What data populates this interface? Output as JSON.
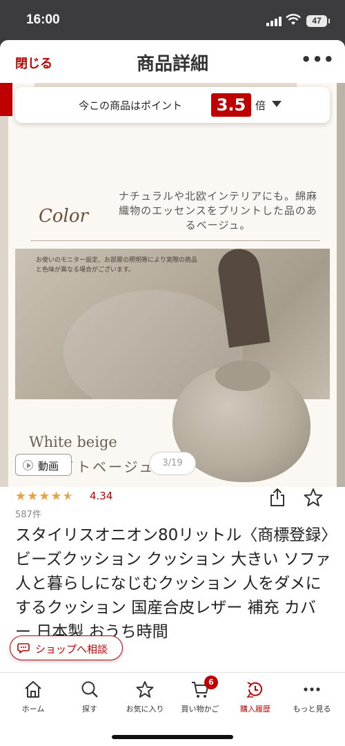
{
  "status_bar": {
    "time": "16:00",
    "battery": "47"
  },
  "header": {
    "close_label": "閉じる",
    "title": "商品詳細",
    "more_label": "•••"
  },
  "points_banner": {
    "prefix": "今この商品はポイント",
    "rate": "3.5",
    "unit": "倍"
  },
  "product_image": {
    "color_word": "Color",
    "description": "ナチュラルや北欧インテリアにも。綿麻織物のエッセンスをプリントした品のあるベージュ。",
    "monitor_note": "お使いのモニター設定、お部屋の照明等により実際の商品と色味が異なる場合がございます。",
    "color_name_en": "White beige",
    "color_name_ja": "ホワイトベージュ"
  },
  "media": {
    "video_label": "動画",
    "counter": "3/19"
  },
  "rating": {
    "value": "4.34",
    "stars": 4.34,
    "reviews": "587件"
  },
  "product": {
    "name": "スタイリスオニオン80リットル〈商標登録〉ビーズクッション クッション 大きい ソファ 人と暮らしになじむクッション 人をダメにするクッション 国産合皮レザー 補充 カバー 日本製 おうち時間"
  },
  "shop_chat": {
    "label": "ショップへ相談"
  },
  "tabbar": {
    "items": [
      {
        "label": "ホーム",
        "icon": "home-icon"
      },
      {
        "label": "探す",
        "icon": "search-icon"
      },
      {
        "label": "お気に入り",
        "icon": "star-icon"
      },
      {
        "label": "買い物かご",
        "icon": "cart-icon",
        "badge": "6"
      },
      {
        "label": "購入履歴",
        "icon": "history-icon",
        "active": true
      },
      {
        "label": "もっと見る",
        "icon": "more-icon"
      }
    ]
  },
  "colors": {
    "accent": "#bf0000",
    "star": "#e8a33d"
  }
}
